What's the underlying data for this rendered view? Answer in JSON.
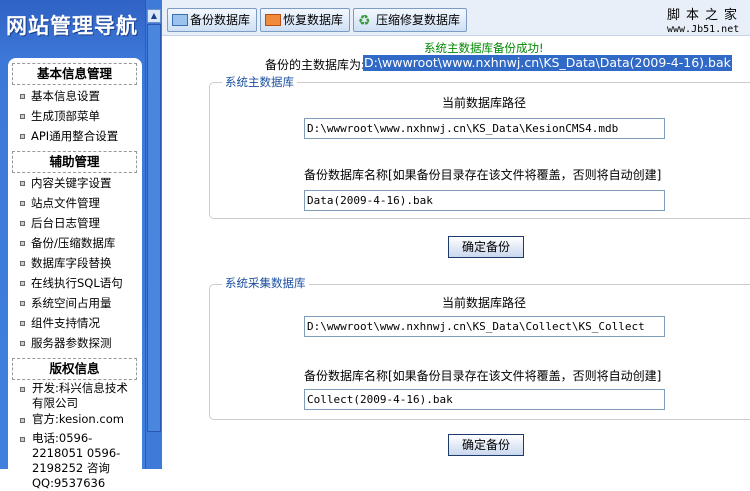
{
  "sidebar": {
    "title": "网站管理导航",
    "sections": [
      {
        "title": "基本信息管理",
        "items": [
          "基本信息设置",
          "生成顶部菜单",
          "API通用整合设置"
        ]
      },
      {
        "title": "辅助管理",
        "items": [
          "内容关键字设置",
          "站点文件管理",
          "后台日志管理",
          "备份/压缩数据库",
          "数据库字段替换",
          "在线执行SQL语句",
          "系统空间占用量",
          "组件支持情况",
          "服务器参数探测"
        ]
      },
      {
        "title": "版权信息",
        "items": [
          "开发:科兴信息技术有限公司",
          "官方:kesion.com",
          "电话:0596-2218051 0596-2198252 咨询QQ:9537636"
        ]
      }
    ]
  },
  "toolbar": {
    "backup": "备份数据库",
    "restore": "恢复数据库",
    "compact": "压缩修复数据库"
  },
  "watermark": {
    "title": "脚本之家",
    "url": "www.Jb51.net"
  },
  "result": {
    "message": "系统主数据库备份成功!",
    "label": "备份的主数据库为:",
    "path": "D:\\wwwroot\\www.nxhnwj.cn\\KS_Data\\Data(2009-4-16).bak"
  },
  "main_db": {
    "legend": "系统主数据库",
    "path_label": "当前数据库路径",
    "path_value": "D:\\wwwroot\\www.nxhnwj.cn\\KS_Data\\KesionCMS4.mdb",
    "name_label": "备份数据库名称[如果备份目录存在该文件将覆盖，否则将自动创建]",
    "name_value": "Data(2009-4-16).bak",
    "button": "确定备份"
  },
  "collect_db": {
    "legend": "系统采集数据库",
    "path_label": "当前数据库路径",
    "path_value": "D:\\wwwroot\\www.nxhnwj.cn\\KS_Data\\Collect\\KS_Collect",
    "name_label": "备份数据库名称[如果备份目录存在该文件将覆盖，否则将自动创建]",
    "name_value": "Collect(2009-4-16).bak",
    "button": "确定备份"
  }
}
